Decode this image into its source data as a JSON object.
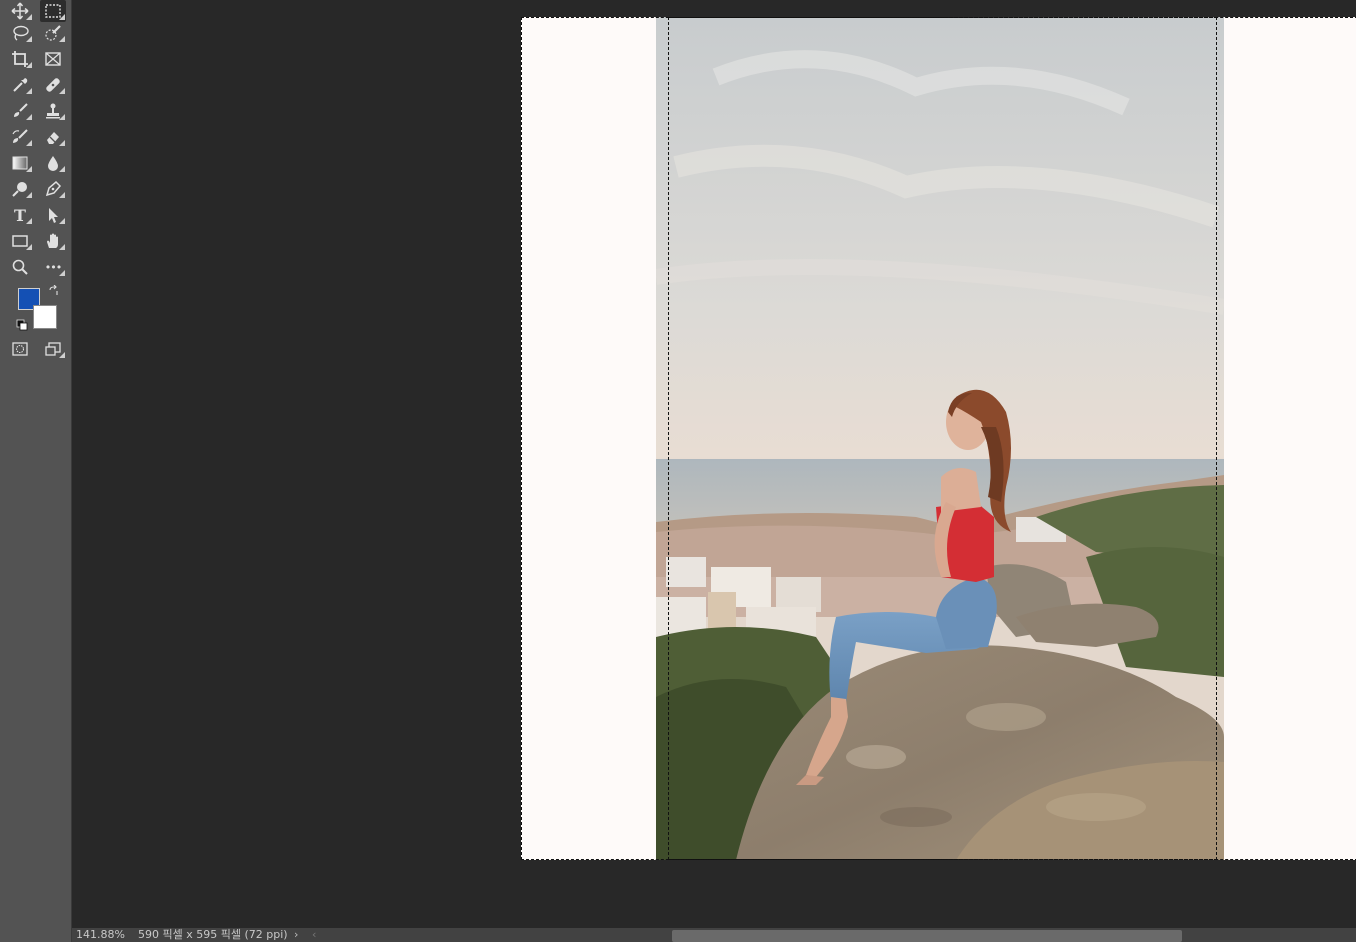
{
  "colors": {
    "foreground": "#1450b4",
    "background": "#ffffff",
    "workspace": "#282828",
    "toolbar": "#535353",
    "document_fill": "#fefaf9"
  },
  "toolbar": {
    "tools": [
      {
        "name": "move-tool",
        "icon": "move-icon"
      },
      {
        "name": "rectangular-marquee-tool",
        "icon": "marquee-icon",
        "active": true
      },
      {
        "name": "lasso-tool",
        "icon": "lasso-icon"
      },
      {
        "name": "quick-selection-tool",
        "icon": "quick-selection-icon"
      },
      {
        "name": "crop-tool",
        "icon": "crop-icon"
      },
      {
        "name": "frame-tool",
        "icon": "frame-icon"
      },
      {
        "name": "eyedropper-tool",
        "icon": "eyedropper-icon"
      },
      {
        "name": "healing-brush-tool",
        "icon": "bandage-icon"
      },
      {
        "name": "brush-tool",
        "icon": "brush-icon"
      },
      {
        "name": "clone-stamp-tool",
        "icon": "stamp-icon"
      },
      {
        "name": "history-brush-tool",
        "icon": "history-brush-icon"
      },
      {
        "name": "eraser-tool",
        "icon": "eraser-icon"
      },
      {
        "name": "gradient-tool",
        "icon": "gradient-icon"
      },
      {
        "name": "blur-tool",
        "icon": "drop-icon"
      },
      {
        "name": "dodge-tool",
        "icon": "dodge-icon"
      },
      {
        "name": "pen-tool",
        "icon": "pen-icon"
      },
      {
        "name": "type-tool",
        "icon": "type-icon",
        "glyph": "T"
      },
      {
        "name": "path-selection-tool",
        "icon": "arrow-icon"
      },
      {
        "name": "rectangle-tool",
        "icon": "rectangle-icon"
      },
      {
        "name": "hand-tool",
        "icon": "hand-icon"
      },
      {
        "name": "zoom-tool",
        "icon": "zoom-icon"
      },
      {
        "name": "edit-toolbar",
        "icon": "ellipsis-icon",
        "glyph": "•••"
      },
      {
        "name": "quick-mask",
        "icon": "quick-mask-icon"
      },
      {
        "name": "screen-mode",
        "icon": "screen-mode-icon"
      }
    ]
  },
  "status": {
    "zoom": "141.88%",
    "doc_info": "590 픽셀 x 595 픽셀 (72 ppi)",
    "next_arrow": "›",
    "prev_arrow": "‹"
  }
}
